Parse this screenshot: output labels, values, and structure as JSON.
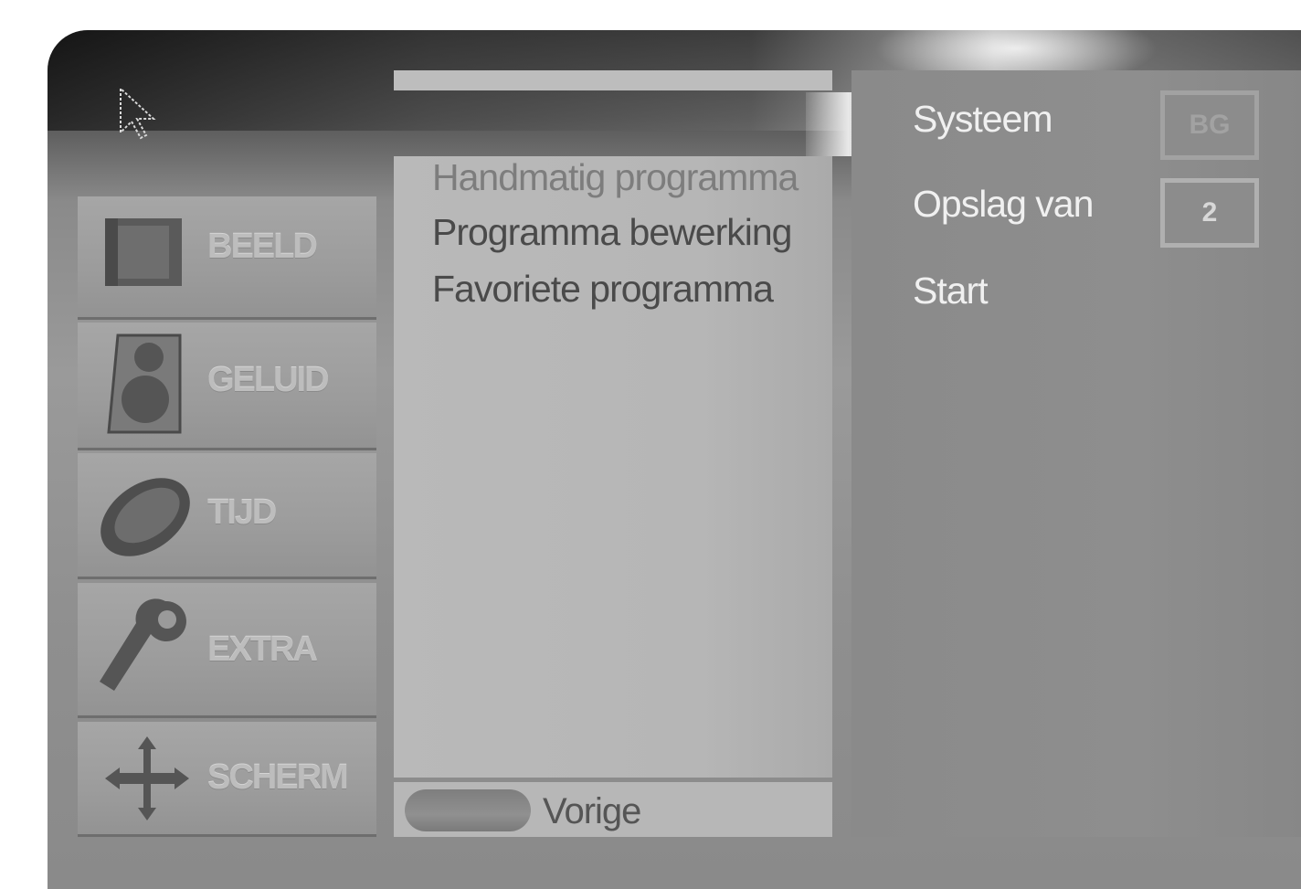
{
  "sidebar": {
    "items": [
      {
        "label": "BEELD",
        "icon": "picture-icon"
      },
      {
        "label": "GELUID",
        "icon": "speaker-icon"
      },
      {
        "label": "TIJD",
        "icon": "clock-icon"
      },
      {
        "label": "EXTRA",
        "icon": "wrench-icon"
      },
      {
        "label": "SCHERM",
        "icon": "move-arrows-icon"
      }
    ]
  },
  "submenu": {
    "items": [
      {
        "label": "Handmatig programma"
      },
      {
        "label": "Programma bewerking"
      },
      {
        "label": "Favoriete programma"
      }
    ]
  },
  "footer": {
    "back_label": "Vorige"
  },
  "options": {
    "items": [
      {
        "label": "Systeem",
        "value": "BG"
      },
      {
        "label": "Opslag van",
        "value": "2"
      },
      {
        "label": "Start"
      }
    ]
  },
  "colors": {
    "background": "#9a9a9a",
    "text_light": "#f0f0f0",
    "text_dark": "#4a4a4a"
  }
}
